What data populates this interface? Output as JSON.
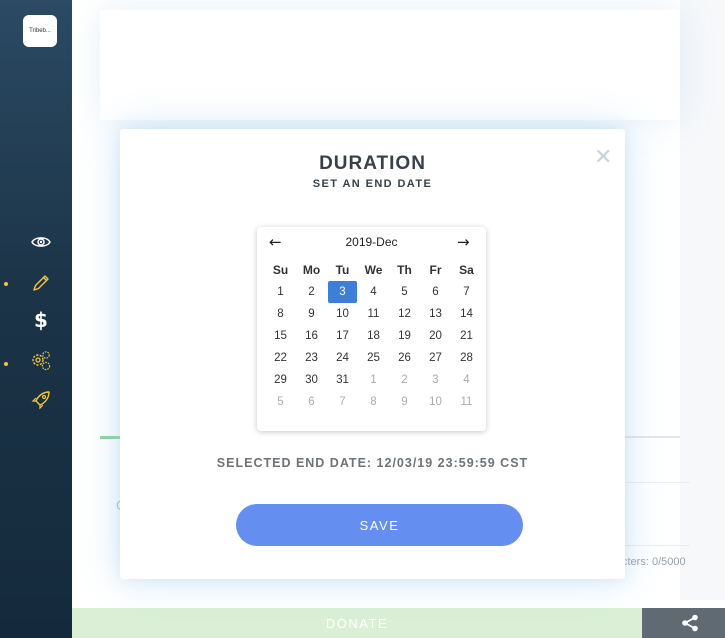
{
  "colors": {
    "sidebar": "#1c3448",
    "accent": "#648ff1",
    "selected_day": "#3d7fd8",
    "indicator_dot": "#f4c542"
  },
  "sidebar": {
    "logo_text": "Tribeb...",
    "items": [
      {
        "icon": "eye-icon"
      },
      {
        "icon": "pencil-icon",
        "active": true
      },
      {
        "icon": "dollar-icon",
        "glyph": "$"
      },
      {
        "icon": "gears-icon",
        "active": true
      },
      {
        "icon": "rocket-icon"
      }
    ]
  },
  "background": {
    "partial_letter": "C",
    "char_count": "cters: 0/5000",
    "donate_label": "DONATE"
  },
  "modal": {
    "close_glyph": "✕",
    "title": "DURATION",
    "subtitle": "SET AN END DATE",
    "selected_label": "SELECTED END DATE: 12/03/19 23:59:59 CST",
    "save_label": "SAVE"
  },
  "calendar": {
    "prev": "←",
    "next": "→",
    "month": "2019-Dec",
    "weekdays": [
      "Su",
      "Mo",
      "Tu",
      "We",
      "Th",
      "Fr",
      "Sa"
    ],
    "weeks": [
      [
        {
          "d": "1"
        },
        {
          "d": "2"
        },
        {
          "d": "3",
          "sel": true
        },
        {
          "d": "4"
        },
        {
          "d": "5"
        },
        {
          "d": "6"
        },
        {
          "d": "7"
        }
      ],
      [
        {
          "d": "8"
        },
        {
          "d": "9"
        },
        {
          "d": "10"
        },
        {
          "d": "11"
        },
        {
          "d": "12"
        },
        {
          "d": "13"
        },
        {
          "d": "14"
        }
      ],
      [
        {
          "d": "15"
        },
        {
          "d": "16"
        },
        {
          "d": "17"
        },
        {
          "d": "18"
        },
        {
          "d": "19"
        },
        {
          "d": "20"
        },
        {
          "d": "21"
        }
      ],
      [
        {
          "d": "22"
        },
        {
          "d": "23"
        },
        {
          "d": "24"
        },
        {
          "d": "25"
        },
        {
          "d": "26"
        },
        {
          "d": "27"
        },
        {
          "d": "28"
        }
      ],
      [
        {
          "d": "29"
        },
        {
          "d": "30"
        },
        {
          "d": "31"
        },
        {
          "d": "1",
          "muted": true
        },
        {
          "d": "2",
          "muted": true
        },
        {
          "d": "3",
          "muted": true
        },
        {
          "d": "4",
          "muted": true
        }
      ],
      [
        {
          "d": "5",
          "muted": true
        },
        {
          "d": "6",
          "muted": true
        },
        {
          "d": "7",
          "muted": true
        },
        {
          "d": "8",
          "muted": true
        },
        {
          "d": "9",
          "muted": true
        },
        {
          "d": "10",
          "muted": true
        },
        {
          "d": "11",
          "muted": true
        }
      ]
    ]
  }
}
